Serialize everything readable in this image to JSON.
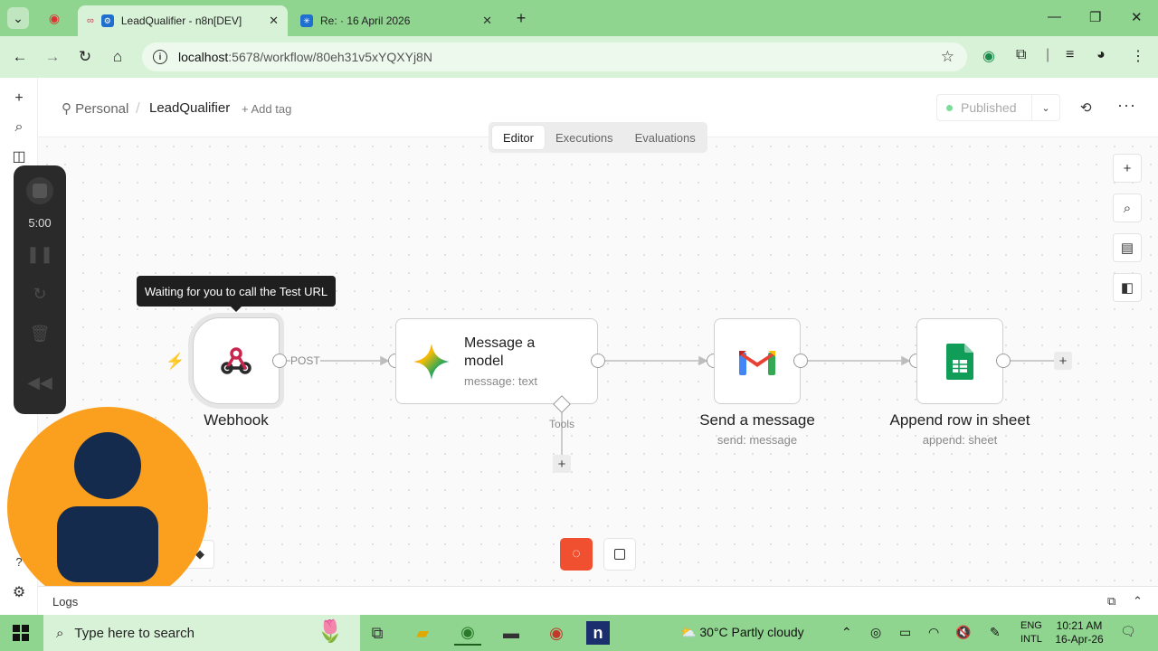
{
  "browser": {
    "tabs": [
      {
        "title": "LeadQualifier - n8n[DEV]",
        "active": true
      },
      {
        "title": "Re: · 16 April 2026",
        "active": false
      }
    ],
    "url_host": "localhost",
    "url_path": ":5678/workflow/80eh31v5xYQXYj8N"
  },
  "app": {
    "breadcrumb_personal": "Personal",
    "workflow_name": "LeadQualifier",
    "add_tag": "+ Add tag",
    "published": "Published",
    "mode_tabs": [
      "Editor",
      "Executions",
      "Evaluations"
    ],
    "active_mode": "Editor",
    "tooltip": "Waiting for you to call the Test URL",
    "logs": "Logs"
  },
  "nodes": {
    "webhook": {
      "label": "Webhook"
    },
    "edge_post": "POST",
    "model": {
      "title": "Message a model",
      "sub": "message: text",
      "tools": "Tools"
    },
    "gmail": {
      "label": "Send a message",
      "sub": "send: message"
    },
    "sheets": {
      "label": "Append row in sheet",
      "sub": "append: sheet"
    }
  },
  "recorder": {
    "time": "5:00"
  },
  "taskbar": {
    "search_placeholder": "Type here to search",
    "weather": "30°C  Partly cloudy",
    "lang1": "ENG",
    "lang2": "INTL",
    "time": "10:21 AM",
    "date": "16-Apr-26"
  },
  "colors": {
    "accent": "#f0502f",
    "chrome": "#8fd48f",
    "avatar_bg": "#fb9f1f"
  }
}
